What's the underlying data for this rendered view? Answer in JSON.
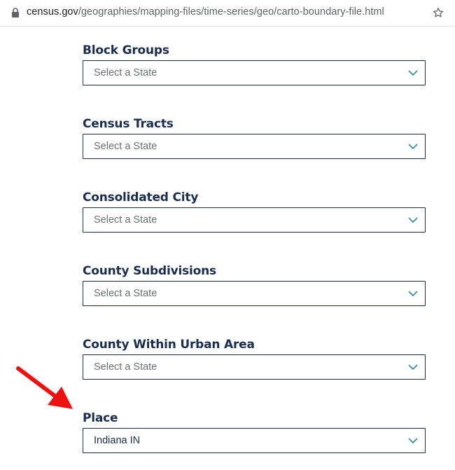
{
  "browser": {
    "url_host": "census.gov",
    "url_path": "/geographies/mapping-files/time-series/geo/carto-boundary-file.html",
    "lock_icon": "lock-icon",
    "bookmark_icon": "star-icon"
  },
  "fields": [
    {
      "label": "Block Groups",
      "value": "Select a State",
      "selected": false
    },
    {
      "label": "Census Tracts",
      "value": "Select a State",
      "selected": false
    },
    {
      "label": "Consolidated City",
      "value": "Select a State",
      "selected": false
    },
    {
      "label": "County Subdivisions",
      "value": "Select a State",
      "selected": false
    },
    {
      "label": "County Within Urban Area",
      "value": "Select a State",
      "selected": false
    },
    {
      "label": "Place",
      "value": "Indiana IN",
      "selected": true
    }
  ],
  "annotation": {
    "icon": "red-arrow-icon",
    "color": "#ee1111",
    "points_to": "Place"
  },
  "colors": {
    "label_text": "#1b2d4f",
    "border": "#1b2d4f",
    "chevron": "#2a8aa0",
    "placeholder": "#6b6f75"
  }
}
